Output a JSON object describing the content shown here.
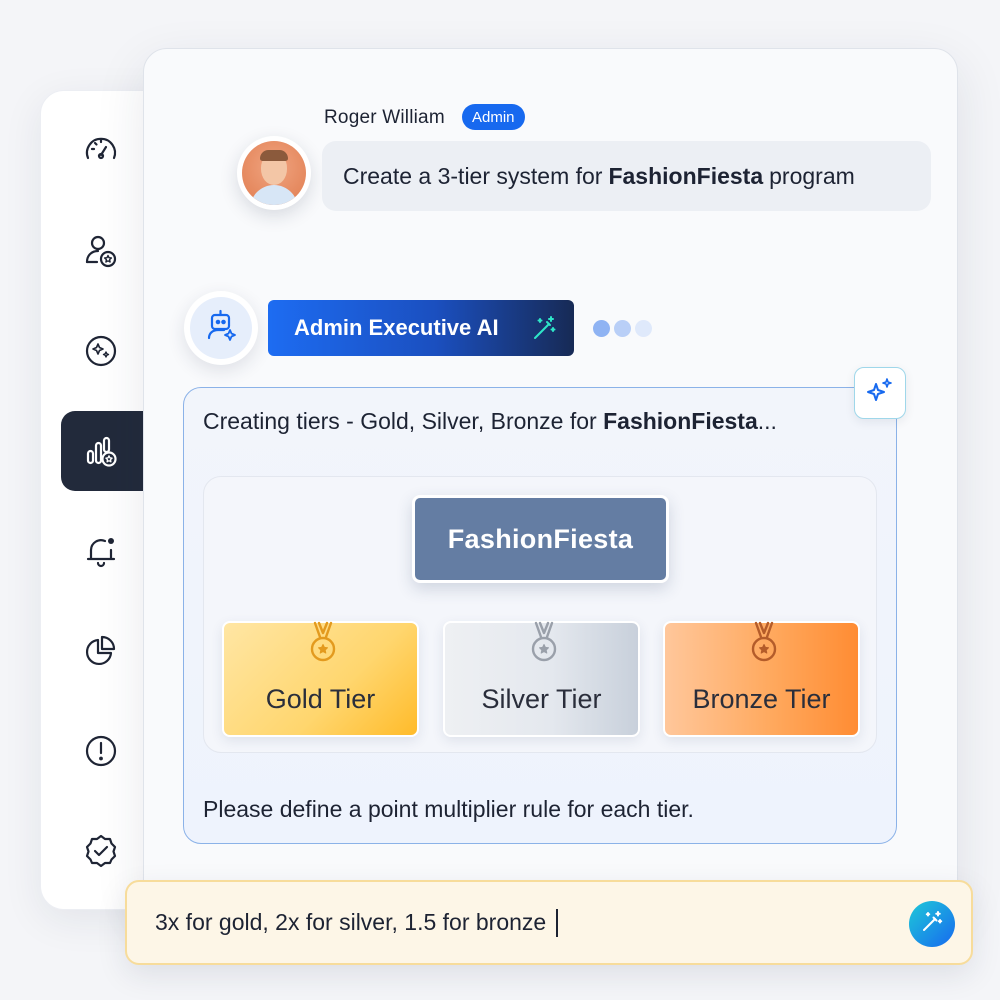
{
  "sidebar": {
    "items": [
      {
        "icon": "speedometer-icon",
        "active": false
      },
      {
        "icon": "user-star-icon",
        "active": false
      },
      {
        "icon": "sparkle-badge-icon",
        "active": false
      },
      {
        "icon": "tiers-chart-icon",
        "active": true
      },
      {
        "icon": "bell-icon",
        "active": false
      },
      {
        "icon": "pie-chart-icon",
        "active": false
      },
      {
        "icon": "alert-icon",
        "active": false
      },
      {
        "icon": "verified-badge-icon",
        "active": false
      }
    ]
  },
  "chat": {
    "user": {
      "name": "Roger William",
      "role": "Admin",
      "message_prefix": "Create a 3-tier system for",
      "message_bold": "FashionFiesta",
      "message_suffix": "program"
    },
    "ai": {
      "name": "Admin Executive AI",
      "typing_dot_colors": [
        "#8fb3f3",
        "#b9cff7",
        "#dfe9fb"
      ],
      "message_prefix": "Creating tiers - Gold, Silver, Bronze for",
      "message_bold": "FashionFiesta",
      "message_suffix": "...",
      "program_name": "FashionFiesta",
      "tiers": [
        {
          "label": "Gold Tier",
          "medal_color": "#e39a1e"
        },
        {
          "label": "Silver Tier",
          "medal_color": "#9aa0aa"
        },
        {
          "label": "Bronze Tier",
          "medal_color": "#b45c2a"
        }
      ],
      "question": "Please define a point multiplier rule for each tier."
    }
  },
  "composer": {
    "value": "3x for gold, 2x for silver, 1.5 for bronze"
  },
  "colors": {
    "accent": "#1769ef",
    "sidebar_active": "#222a3b",
    "program_node": "#647da3"
  }
}
